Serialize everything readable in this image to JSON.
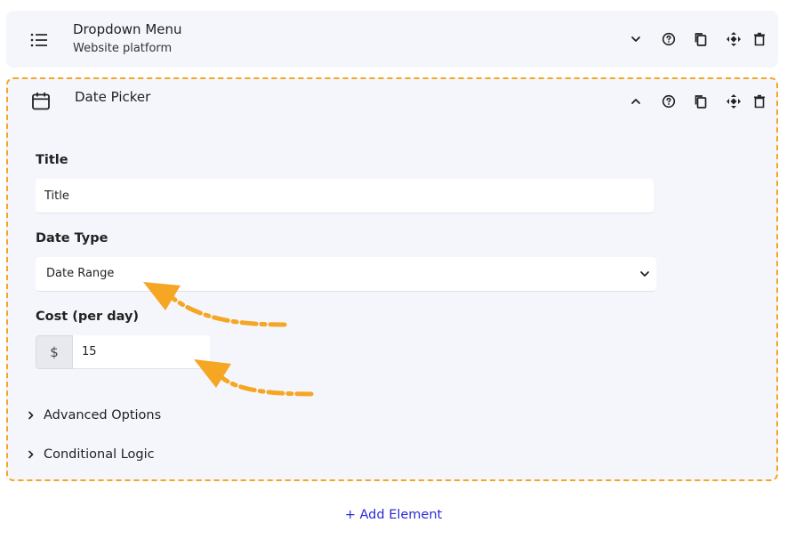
{
  "dropdown_card": {
    "title": "Dropdown Menu",
    "subtitle": "Website platform",
    "icon": "list-icon"
  },
  "datepicker_card": {
    "title": "Date Picker",
    "icon": "calendar-icon",
    "fields": {
      "title_label": "Title",
      "title_value": "Title",
      "date_type_label": "Date Type",
      "date_type_value": "Date Range",
      "cost_label": "Cost (per day)",
      "currency_symbol": "$",
      "cost_value": "15"
    },
    "sections": {
      "advanced": "Advanced Options",
      "conditional": "Conditional Logic"
    }
  },
  "add_element_label": "+ Add Element",
  "colors": {
    "accent_dashed": "#f5a623",
    "link": "#2b2bd6",
    "card_bg": "#f5f6fc"
  }
}
